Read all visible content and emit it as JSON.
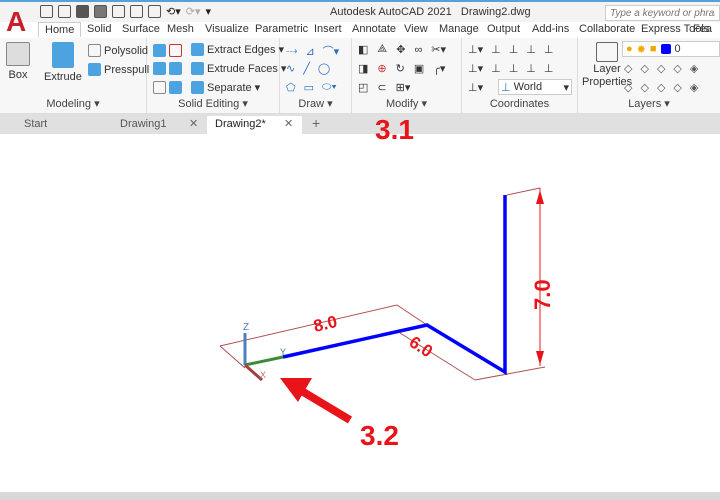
{
  "app": {
    "title": "Autodesk AutoCAD 2021",
    "document": "Drawing2.dwg",
    "search_placeholder": "Type a keyword or phrase"
  },
  "ribbon_tabs": [
    "Home",
    "Solid",
    "Surface",
    "Mesh",
    "Visualize",
    "Parametric",
    "Insert",
    "Annotate",
    "View",
    "Manage",
    "Output",
    "Add-ins",
    "Collaborate",
    "Express Tools",
    "Fea"
  ],
  "panels": {
    "modeling": {
      "label": "Modeling",
      "box": "Box",
      "extrude": "Extrude",
      "polysolid": "Polysolid",
      "presspull": "Presspull"
    },
    "solid_editing": {
      "label": "Solid Editing",
      "extract_edges": "Extract Edges",
      "extrude_faces": "Extrude Faces",
      "separate": "Separate"
    },
    "draw": {
      "label": "Draw"
    },
    "modify": {
      "label": "Modify"
    },
    "coordinates": {
      "label": "Coordinates",
      "ucs": "World"
    },
    "layers": {
      "label": "Layers",
      "layer_properties_1": "Layer",
      "layer_properties_2": "Properties",
      "current_layer": "0",
      "layer_color": "#0000ff"
    }
  },
  "file_tabs": [
    {
      "label": "Start"
    },
    {
      "label": "Drawing1"
    },
    {
      "label": "Drawing2*",
      "active": true
    }
  ],
  "drawing": {
    "dims": [
      "8.0",
      "6.0",
      "7.0"
    ],
    "ucs": {
      "x": "X",
      "y": "Y",
      "z": "Z"
    },
    "line_color": "#0000ff",
    "dim_color": "#e8141a"
  },
  "annotations": {
    "step1": "3.1",
    "step2": "3.2"
  }
}
